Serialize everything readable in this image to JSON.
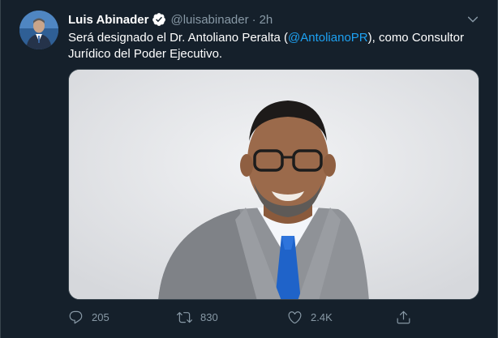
{
  "tweet": {
    "author_name": "Luis Abinader",
    "handle": "@luisabinader",
    "separator": "·",
    "time": "2h",
    "text_before": "Será designado el Dr. Antoliano Peralta (",
    "mention": "@AntolianoPR",
    "text_after": "), como Consultor Jurídico del Poder Ejecutivo.",
    "icons": {
      "verified": "verified-badge-icon",
      "menu": "chevron-down-icon",
      "reply": "reply-icon",
      "retweet": "retweet-icon",
      "like": "heart-icon",
      "share": "share-icon"
    },
    "stats": {
      "replies": "205",
      "retweets": "830",
      "likes": "2.4K"
    }
  },
  "colors": {
    "background": "#15202b",
    "accent": "#1da1f2",
    "secondary_text": "#8899a6",
    "border": "#38444d"
  }
}
